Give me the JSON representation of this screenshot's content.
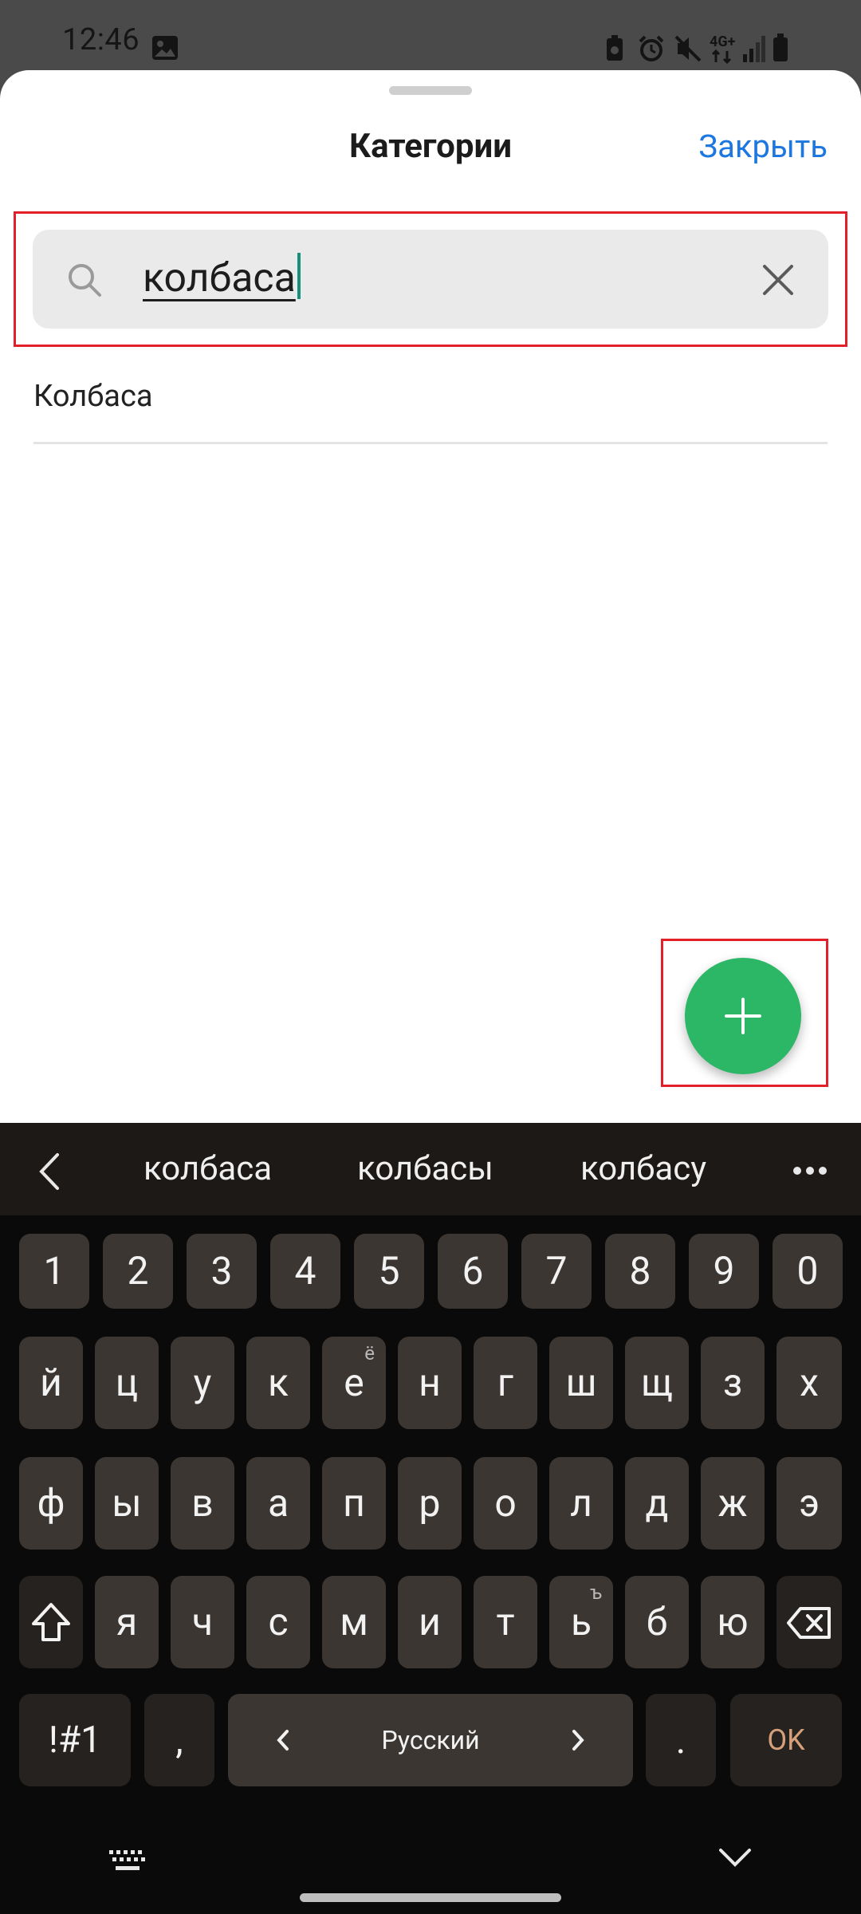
{
  "status_bar": {
    "time": "12:46",
    "network_label": "4G+"
  },
  "sheet": {
    "title": "Категории",
    "close_label": "Закрыть"
  },
  "search": {
    "value": "колбаса"
  },
  "results": [
    {
      "label": "Колбаса"
    }
  ],
  "fab": {
    "icon": "plus-icon",
    "color": "#2bb765"
  },
  "keyboard": {
    "suggestions": [
      "колбаса",
      "колбасы",
      "колбасу"
    ],
    "number_row": [
      "1",
      "2",
      "3",
      "4",
      "5",
      "6",
      "7",
      "8",
      "9",
      "0"
    ],
    "row1": [
      "й",
      "ц",
      "у",
      "к",
      "е",
      "н",
      "г",
      "ш",
      "щ",
      "з",
      "х"
    ],
    "row1_alt_e": "ё",
    "row2": [
      "ф",
      "ы",
      "в",
      "а",
      "п",
      "р",
      "о",
      "л",
      "д",
      "ж",
      "э"
    ],
    "row3": [
      "я",
      "ч",
      "с",
      "м",
      "и",
      "т",
      "ь",
      "б",
      "ю"
    ],
    "row3_alt_soft": "ъ",
    "symbols_label": "!#1",
    "comma_label": ",",
    "space_label": "Русский",
    "period_label": ".",
    "ok_label": "OK"
  },
  "colors": {
    "accent": "#1d77e0",
    "fab": "#2bb765",
    "highlight": "#e3202a",
    "keyboard_bg": "#0a0a0a",
    "key_bg": "#3c3632"
  }
}
